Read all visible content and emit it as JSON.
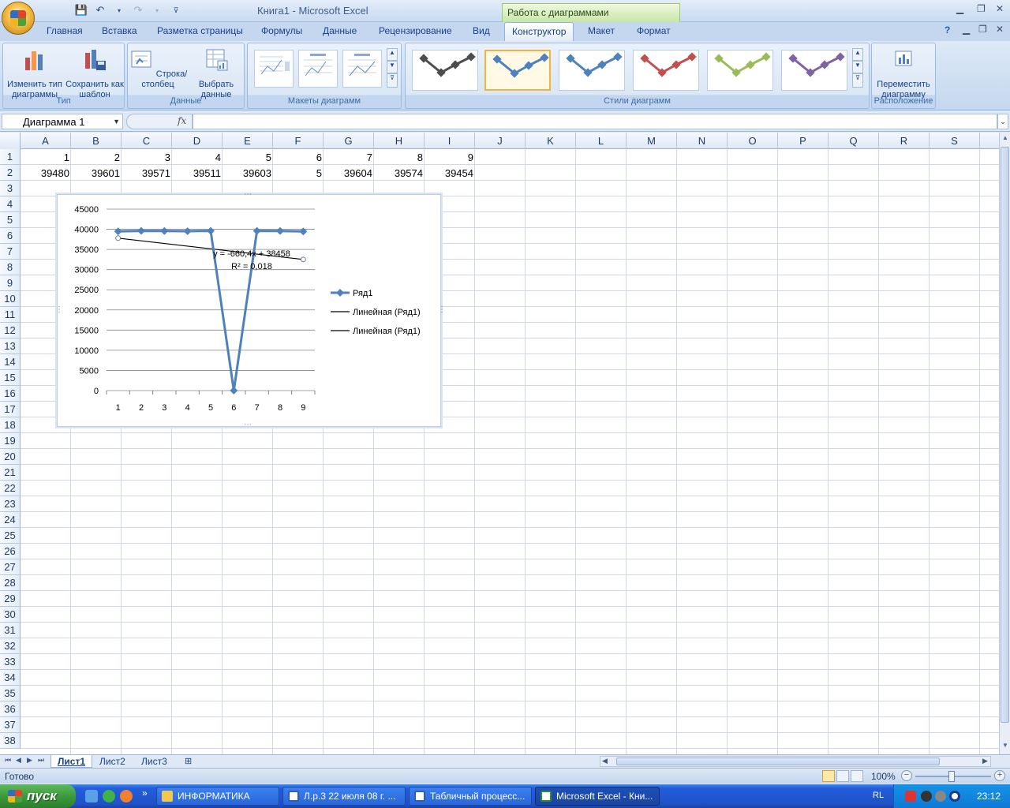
{
  "window": {
    "title": "Книга1 - Microsoft Excel",
    "context_tab_group": "Работа с диаграммами"
  },
  "ribbon": {
    "tabs": [
      "Главная",
      "Вставка",
      "Разметка страницы",
      "Формулы",
      "Данные",
      "Рецензирование",
      "Вид",
      "Конструктор",
      "Макет",
      "Формат"
    ],
    "active_tab": "Конструктор",
    "groups": {
      "type": {
        "label": "Тип",
        "change_type": "Изменить тип диаграммы",
        "save_template": "Сохранить как шаблон"
      },
      "data": {
        "label": "Данные",
        "switch_row_col": "Строка/столбец",
        "select_data": "Выбрать данные"
      },
      "layouts": {
        "label": "Макеты диаграмм"
      },
      "styles": {
        "label": "Стили диаграмм",
        "colors": [
          "#4d4d4d",
          "#4f81bd",
          "#4f81bd",
          "#c0504d",
          "#9bbb59",
          "#8064a2"
        ]
      },
      "location": {
        "label": "Расположение",
        "move_chart": "Переместить диаграмму"
      }
    }
  },
  "formula_bar": {
    "name_box": "Диаграмма 1",
    "fx": "fx",
    "formula": ""
  },
  "sheet": {
    "columns": [
      "A",
      "B",
      "C",
      "D",
      "E",
      "F",
      "G",
      "H",
      "I",
      "J",
      "K",
      "L",
      "M",
      "N",
      "O",
      "P",
      "Q",
      "R",
      "S"
    ],
    "row_count": 38,
    "rows": [
      [
        "1",
        "2",
        "3",
        "4",
        "5",
        "6",
        "7",
        "8",
        "9"
      ],
      [
        "39480",
        "39601",
        "39571",
        "39511",
        "39603",
        "5",
        "39604",
        "39574",
        "39454"
      ]
    ]
  },
  "chart_data": {
    "type": "line",
    "title": "",
    "categories": [
      "1",
      "2",
      "3",
      "4",
      "5",
      "6",
      "7",
      "8",
      "9"
    ],
    "series": [
      {
        "name": "Ряд1",
        "values": [
          39480,
          39601,
          39571,
          39511,
          39603,
          5,
          39604,
          39574,
          39454
        ],
        "color": "#4f81bd"
      }
    ],
    "trendline": {
      "name": "Линейная (Ряд1)",
      "slope": -660.4,
      "intercept": 38458,
      "color": "#000000"
    },
    "equation": "y = -660,4x + 38458",
    "r_squared": "R² = 0,018",
    "legend": [
      "Ряд1",
      "Линейная (Ряд1)",
      "Линейная (Ряд1)"
    ],
    "legend_position": "right",
    "ylim": [
      0,
      45000
    ],
    "yticks": [
      "45000",
      "40000",
      "35000",
      "30000",
      "25000",
      "20000",
      "15000",
      "10000",
      "5000",
      "0"
    ],
    "grid": true
  },
  "sheet_tabs": [
    "Лист1",
    "Лист2",
    "Лист3"
  ],
  "active_sheet": "Лист1",
  "status": {
    "text": "Готово",
    "zoom": "100%"
  },
  "taskbar": {
    "start": "пуск",
    "tasks": [
      "ИНФОРМАТИКА",
      "Л.р.3 22 июля 08 г. ...",
      "Табличный процесс...",
      "Microsoft Excel - Кни..."
    ],
    "active_task": 3,
    "lang": "RL",
    "clock": "23:12"
  }
}
